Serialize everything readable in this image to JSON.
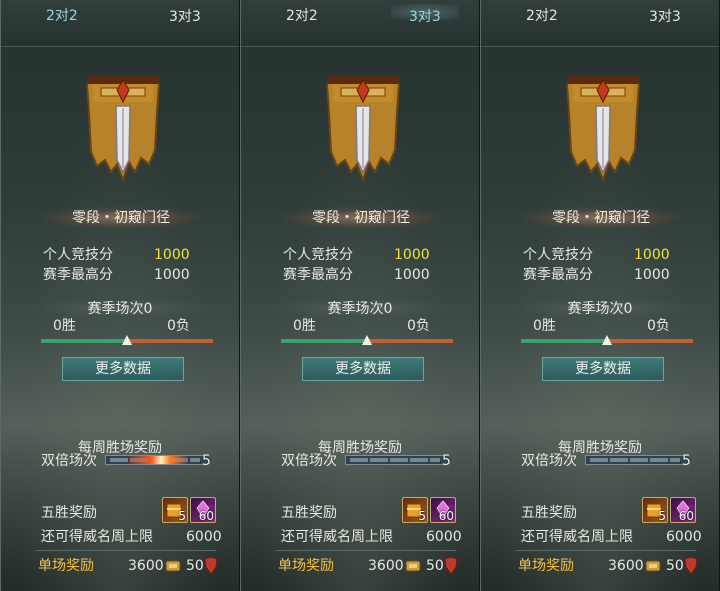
{
  "panels": [
    {
      "tabs": {
        "left": "2对2",
        "right": "3对3",
        "selected": "left"
      },
      "rank_name": "零段・初窥门径",
      "personal_score_label": "个人竞技分",
      "personal_score": "1000",
      "season_best_label": "赛季最高分",
      "season_best": "1000",
      "season_matches": "赛季场次0",
      "wins": "0胜",
      "losses": "0负",
      "win_ratio": 0.5,
      "more_button": "更多数据",
      "weekly_label": "每周胜场奖励",
      "double_label": "双倍场次",
      "double_max": "5",
      "fire": true,
      "five_win_label": "五胜奖励",
      "reward1_count": "5",
      "reward2_count": "60",
      "cap_label": "还可得威名周上限",
      "cap_value": "6000",
      "single_label": "单场奖励",
      "single_value1": "3600",
      "single_value2": "50"
    },
    {
      "tabs": {
        "left": "2对2",
        "right": "3对3",
        "selected": "right"
      },
      "rank_name": "零段・初窥门径",
      "personal_score_label": "个人竞技分",
      "personal_score": "1000",
      "season_best_label": "赛季最高分",
      "season_best": "1000",
      "season_matches": "赛季场次0",
      "wins": "0胜",
      "losses": "0负",
      "win_ratio": 0.5,
      "more_button": "更多数据",
      "weekly_label": "每周胜场奖励",
      "double_label": "双倍场次",
      "double_max": "5",
      "fire": false,
      "five_win_label": "五胜奖励",
      "reward1_count": "5",
      "reward2_count": "60",
      "cap_label": "还可得威名周上限",
      "cap_value": "6000",
      "single_label": "单场奖励",
      "single_value1": "3600",
      "single_value2": "50"
    },
    {
      "tabs": {
        "left": "2对2",
        "right": "3对3",
        "selected": "none"
      },
      "rank_name": "零段・初窥门径",
      "personal_score_label": "个人竞技分",
      "personal_score": "1000",
      "season_best_label": "赛季最高分",
      "season_best": "1000",
      "season_matches": "赛季场次0",
      "wins": "0胜",
      "losses": "0负",
      "win_ratio": 0.5,
      "more_button": "更多数据",
      "weekly_label": "每周胜场奖励",
      "double_label": "双倍场次",
      "double_max": "5",
      "fire": false,
      "five_win_label": "五胜奖励",
      "reward1_count": "5",
      "reward2_count": "60",
      "cap_label": "还可得威名周上限",
      "cap_value": "6000",
      "single_label": "单场奖励",
      "single_value1": "3600",
      "single_value2": "50"
    }
  ],
  "colors": {
    "score_highlight": "#f1e23a",
    "single_reward_label": "#f4c23b",
    "button_bg": "#3f7a78",
    "win_bar": "#3da06a",
    "loss_bar": "#c0603a"
  }
}
